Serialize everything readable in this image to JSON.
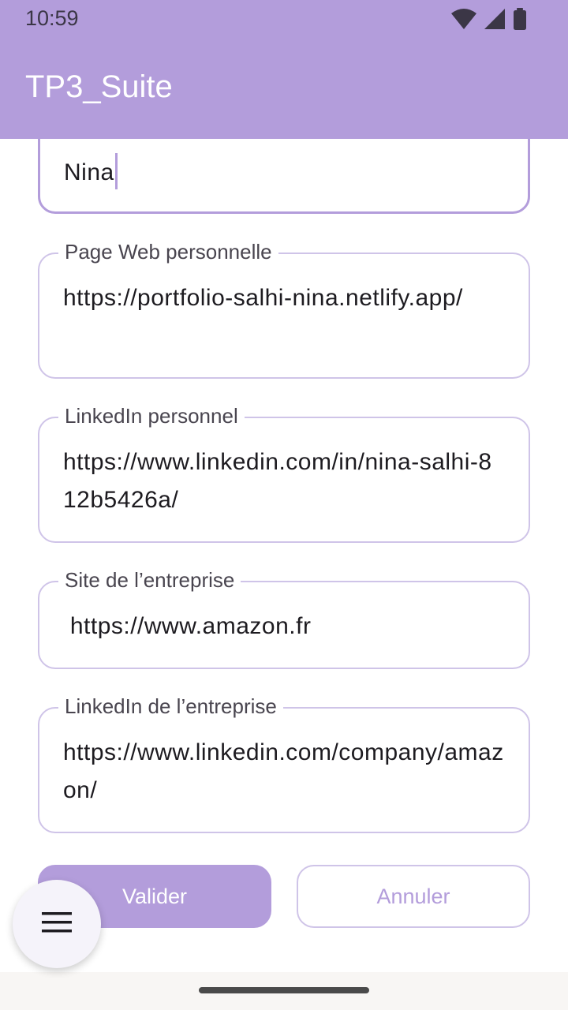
{
  "status_bar": {
    "time": "10:59"
  },
  "app_bar": {
    "title": "TP3_Suite"
  },
  "form": {
    "name_value": "Nina",
    "personal_website": {
      "label": "Page Web personnelle",
      "value": "https://portfolio-salhi-nina.netlify.app/"
    },
    "personal_linkedin": {
      "label": "LinkedIn personnel",
      "value": "https://www.linkedin.com/in/nina-salhi-812b5426a/"
    },
    "company_site": {
      "label": "Site de l’entreprise",
      "value": " https://www.amazon.fr"
    },
    "company_linkedin": {
      "label": "LinkedIn de l’entreprise",
      "value": "https://www.linkedin.com/company/amazon/"
    }
  },
  "buttons": {
    "submit": "Valider",
    "cancel": "Annuler"
  },
  "icons": {
    "wifi": "wifi-icon",
    "signal": "cell-signal-icon",
    "battery": "battery-icon",
    "menu": "hamburger-menu-icon"
  },
  "colors": {
    "primary": "#b39ddb",
    "outline": "#cfc4e8",
    "text": "#1d1b20",
    "label": "#49454f"
  }
}
